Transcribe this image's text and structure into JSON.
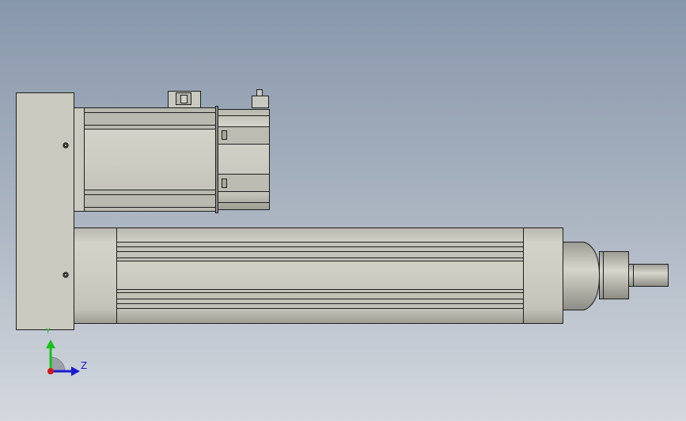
{
  "view": {
    "background_top": "#8797ab",
    "background_bottom": "#d4d9df",
    "part_fill": "#c9c9bf",
    "part_shadow": "#9d9d94",
    "edge_color": "#1e1e1e"
  },
  "triad": {
    "y_label": "Y",
    "z_label": "Z",
    "y_color": "#18c018",
    "z_color": "#1a1ad0",
    "x_color": "#d01818",
    "icons": [
      "axis-triad-icon"
    ]
  }
}
